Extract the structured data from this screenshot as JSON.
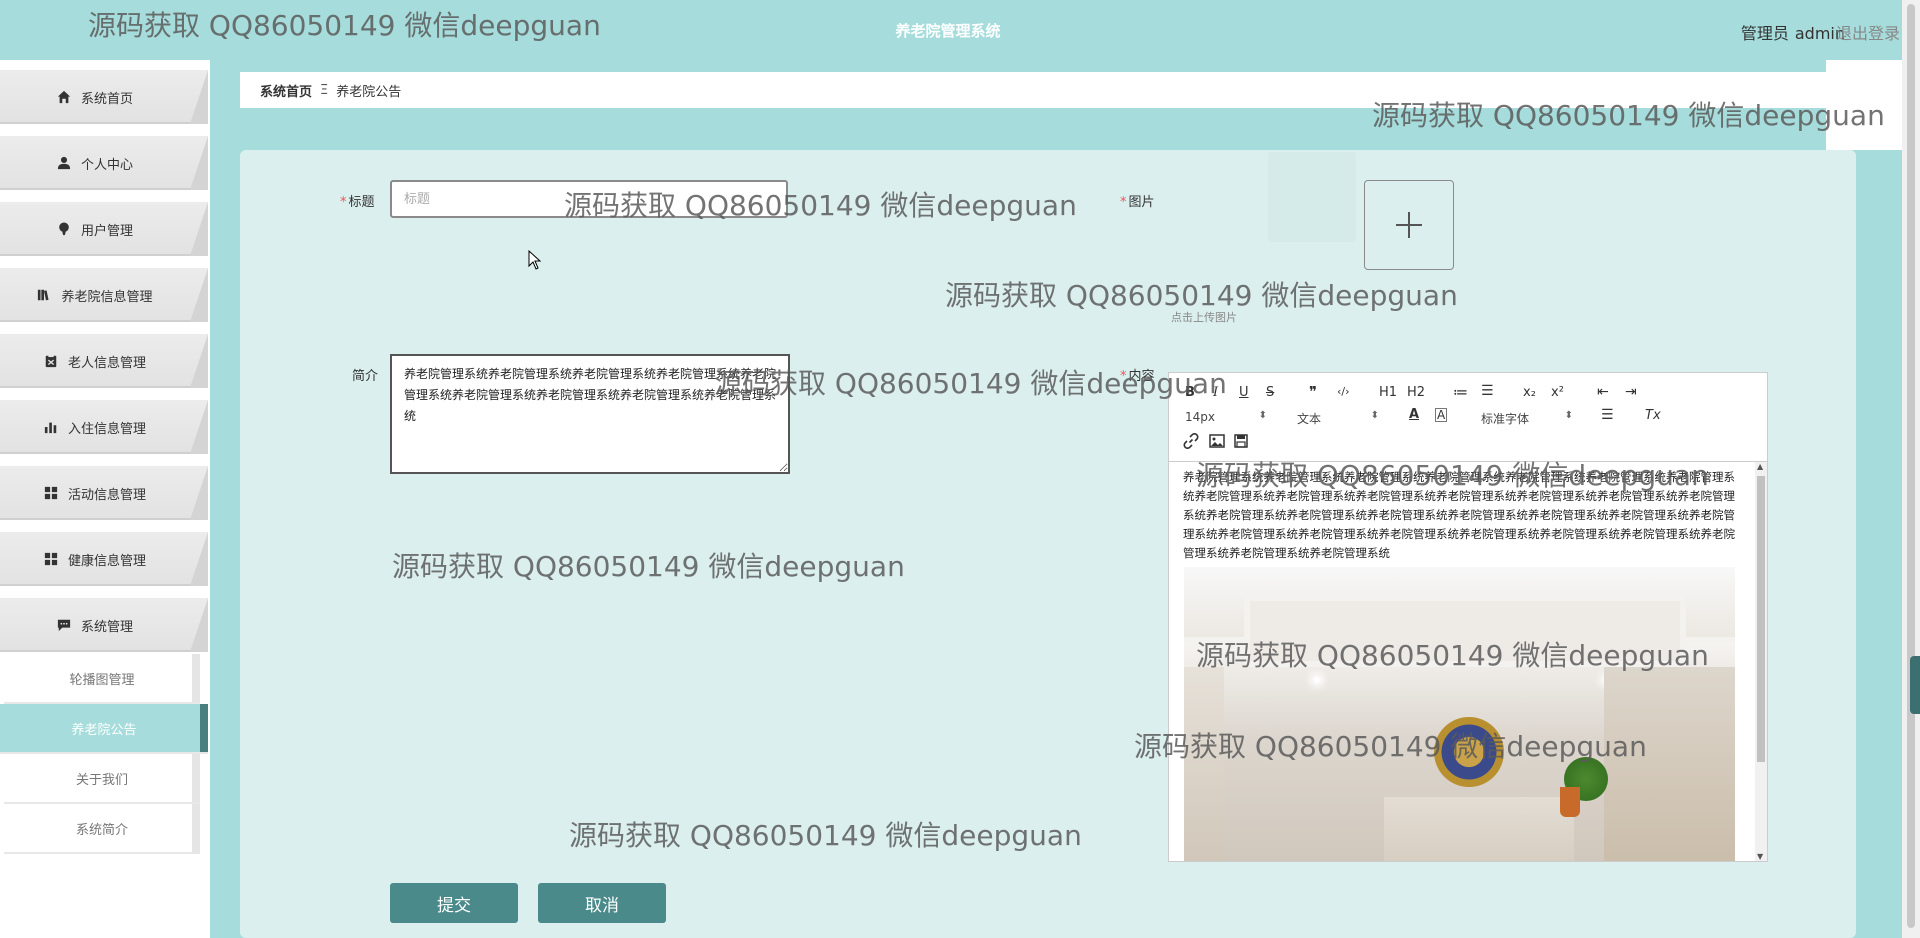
{
  "header": {
    "system_title": "养老院管理系统",
    "admin_label": "管理员",
    "admin_name": "admin",
    "logout_label": "退出登录"
  },
  "sidebar": {
    "items": [
      {
        "label": "系统首页",
        "icon": "home-icon"
      },
      {
        "label": "个人中心",
        "icon": "user-icon"
      },
      {
        "label": "用户管理",
        "icon": "users-icon"
      },
      {
        "label": "养老院信息管理",
        "icon": "book-icon"
      },
      {
        "label": "老人信息管理",
        "icon": "clipboard-icon"
      },
      {
        "label": "入住信息管理",
        "icon": "bar-chart-icon"
      },
      {
        "label": "活动信息管理",
        "icon": "grid-icon"
      },
      {
        "label": "健康信息管理",
        "icon": "grid-icon"
      },
      {
        "label": "系统管理",
        "icon": "message-icon"
      }
    ],
    "sub_items": [
      {
        "label": "轮播图管理",
        "active": false
      },
      {
        "label": "养老院公告",
        "active": true
      },
      {
        "label": "关于我们",
        "active": false
      },
      {
        "label": "系统简介",
        "active": false
      }
    ]
  },
  "breadcrumb": {
    "home": "系统首页",
    "separator": "Ξ",
    "current": "养老院公告"
  },
  "form": {
    "title_label": "标题",
    "title_placeholder": "标题",
    "title_value": "",
    "image_label": "图片",
    "upload_tip": "点击上传图片",
    "intro_label": "简介",
    "intro_value": "养老院管理系统养老院管理系统养老院管理系统养老院管理系统养老院管理系统养老院管理系统养老院管理系统养老院管理系统养老院管理系统",
    "content_label": "内容",
    "submit_label": "提交",
    "cancel_label": "取消"
  },
  "editor": {
    "toolbar": {
      "bold": "B",
      "italic": "I",
      "underline": "U",
      "strike": "S",
      "quote": "❞",
      "code": "‹/›",
      "h1": "H1",
      "h2": "H2",
      "ordered_list": "≔",
      "bullet_list": "☰",
      "subscript": "x₂",
      "superscript": "x²",
      "outdent": "⇤",
      "indent": "⇥",
      "font_size": "14px",
      "block_type": "文本",
      "font_family": "标准字体",
      "clear_format": "Tx"
    },
    "body_text": "养老院管理系统养老院管理系统养老院管理系统养老院管理系统养老院管理系统养老院管理系统养老院管理系统养老院管理系统养老院管理系统养老院管理系统养老院管理系统养老院管理系统养老院管理系统养老院管理系统养老院管理系统养老院管理系统养老院管理系统养老院管理系统养老院管理系统养老院管理系统养老院管理系统养老院管理系统养老院管理系统养老院管理系统养老院管理系统养老院管理系统养老院管理系统养老院管理系统养老院管理系统养老院管理系统"
  },
  "watermark": "源码获取 QQ86050149 微信deepguan",
  "colors": {
    "header_bg": "#a6dcdb",
    "card_bg": "#dcefef",
    "button_bg": "#4a8a8a"
  }
}
